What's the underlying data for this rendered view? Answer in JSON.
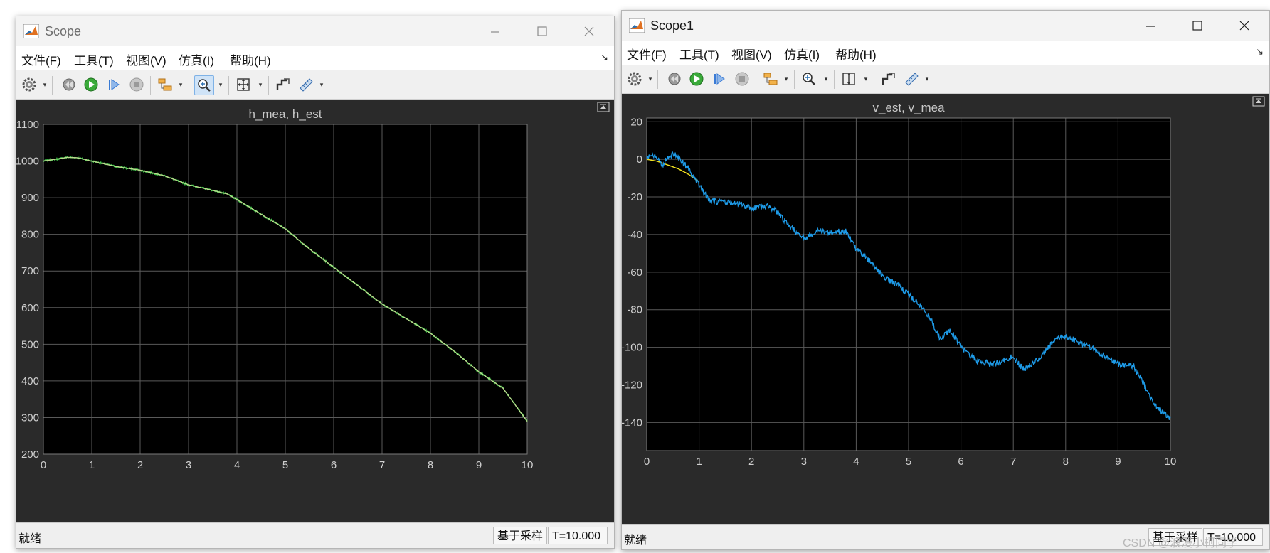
{
  "windows": [
    {
      "title": "Scope",
      "menu": [
        "文件(F)",
        "工具(T)",
        "视图(V)",
        "仿真(I)",
        "帮助(H)"
      ],
      "status": {
        "left": "就绪",
        "mode": "基于采样",
        "time": "T=10.000"
      }
    },
    {
      "title": "Scope1",
      "menu": [
        "文件(F)",
        "工具(T)",
        "视图(V)",
        "仿真(I)",
        "帮助(H)"
      ],
      "status": {
        "left": "就绪",
        "mode": "基于采样",
        "time": "T=10.000"
      }
    }
  ],
  "toolbar_icons": [
    "gear-icon",
    "step-back-icon",
    "run-icon",
    "step-forward-icon",
    "stop-icon",
    "highlight-block-icon",
    "zoom-in-icon",
    "zoom-axes-icon",
    "autoscale-icon",
    "cursor-measure-icon"
  ],
  "watermark": "CSDN @浪漫小柯同学",
  "colors": {
    "plot_bg": "#000000",
    "frame_bg": "#2a2a2a",
    "grid": "#5a5a5a",
    "tick_text": "#d0d0d0",
    "h_mea": "#3dc94a",
    "h_est": "#c0d890",
    "v_est": "#f0e020",
    "v_mea": "#1e9be8"
  },
  "chart_data": [
    {
      "type": "line",
      "title": "h_mea, h_est",
      "xlim": [
        0,
        10
      ],
      "ylim": [
        200,
        1100
      ],
      "xticks": [
        0,
        1,
        2,
        3,
        4,
        5,
        6,
        7,
        8,
        9,
        10
      ],
      "yticks": [
        200,
        300,
        400,
        500,
        600,
        700,
        800,
        900,
        1000,
        1100
      ],
      "grid": true,
      "series": [
        {
          "name": "h_mea",
          "color": "#3dc94a",
          "noise": 2.5,
          "x": [
            0,
            0.3,
            0.5,
            0.7,
            1.0,
            1.5,
            2.0,
            2.5,
            3.0,
            3.5,
            3.8,
            4.0,
            4.5,
            5.0,
            5.5,
            6.0,
            6.5,
            7.0,
            7.5,
            8.0,
            8.5,
            9.0,
            9.5,
            10.0
          ],
          "y": [
            1000,
            1006,
            1010,
            1009,
            1000,
            985,
            975,
            960,
            935,
            920,
            910,
            895,
            855,
            815,
            760,
            710,
            660,
            610,
            570,
            530,
            480,
            425,
            380,
            290
          ]
        },
        {
          "name": "h_est",
          "color": "#c0d890",
          "noise": 0,
          "x": [
            0,
            0.3,
            0.5,
            0.7,
            1.0,
            1.5,
            2.0,
            2.5,
            3.0,
            3.5,
            3.8,
            4.0,
            4.5,
            5.0,
            5.5,
            6.0,
            6.5,
            7.0,
            7.5,
            8.0,
            8.5,
            9.0,
            9.5,
            10.0
          ],
          "y": [
            1000,
            1006,
            1010,
            1009,
            1000,
            985,
            975,
            960,
            935,
            920,
            910,
            895,
            855,
            815,
            760,
            710,
            660,
            610,
            570,
            530,
            480,
            425,
            380,
            290
          ]
        }
      ]
    },
    {
      "type": "line",
      "title": "v_est, v_mea",
      "xlim": [
        0,
        10
      ],
      "ylim": [
        -155,
        22
      ],
      "xticks": [
        0,
        1,
        2,
        3,
        4,
        5,
        6,
        7,
        8,
        9,
        10
      ],
      "yticks": [
        -140,
        -120,
        -100,
        -80,
        -60,
        -40,
        -20,
        0,
        20
      ],
      "grid": true,
      "series": [
        {
          "name": "v_est",
          "color": "#f0e020",
          "noise": 0,
          "x": [
            0,
            0.2,
            0.4,
            0.6,
            0.8,
            1.0
          ],
          "y": [
            0,
            -1,
            -3,
            -5,
            -8,
            -12
          ]
        },
        {
          "name": "v_mea",
          "color": "#1e9be8",
          "noise": 1.6,
          "x": [
            0,
            0.2,
            0.3,
            0.4,
            0.5,
            0.6,
            0.8,
            1.0,
            1.2,
            1.5,
            1.8,
            2.0,
            2.3,
            2.5,
            2.7,
            3.0,
            3.3,
            3.5,
            3.8,
            4.0,
            4.3,
            4.5,
            4.8,
            5.0,
            5.2,
            5.4,
            5.6,
            5.8,
            6.0,
            6.3,
            6.6,
            7.0,
            7.2,
            7.5,
            7.8,
            8.0,
            8.3,
            8.5,
            8.8,
            9.0,
            9.3,
            9.5,
            9.7,
            10.0
          ],
          "y": [
            2,
            1,
            -3,
            1,
            3,
            1,
            -5,
            -14,
            -22,
            -23,
            -24,
            -26,
            -25,
            -28,
            -35,
            -42,
            -38,
            -39,
            -38,
            -48,
            -55,
            -62,
            -67,
            -72,
            -77,
            -84,
            -95,
            -91,
            -100,
            -107,
            -109,
            -105,
            -112,
            -106,
            -96,
            -94,
            -98,
            -100,
            -106,
            -109,
            -110,
            -120,
            -131,
            -138
          ]
        }
      ]
    }
  ]
}
